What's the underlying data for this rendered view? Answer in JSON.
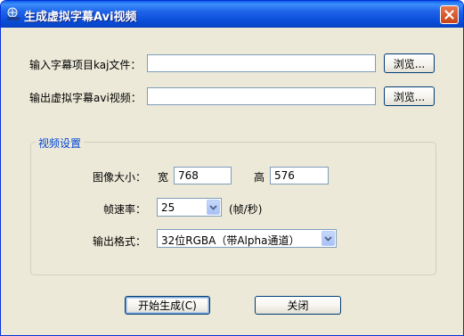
{
  "window": {
    "title": "生成虚拟字幕Avi视频",
    "app_icon": "avi-app-icon",
    "close_icon": "close-icon"
  },
  "input_project": {
    "label": "输入字幕项目kaj文件：",
    "value": "",
    "browse_label": "浏览..."
  },
  "output_video": {
    "label": "输出虚拟字幕avi视频：",
    "value": "",
    "browse_label": "浏览..."
  },
  "video_settings": {
    "group_title": "视频设置",
    "image_size_label": "图像大小：",
    "width_label": "宽",
    "width_value": "768",
    "height_label": "高",
    "height_value": "576",
    "frame_rate_label": "帧速率：",
    "frame_rate_value": "25",
    "frame_rate_unit": "(帧/秒)",
    "output_format_label": "输出格式：",
    "output_format_value": "32位RGBA（带Alpha通道）"
  },
  "buttons": {
    "start_label": "开始生成(C)",
    "close_label": "关闭"
  },
  "colors": {
    "title_bar": "#0A4ED9",
    "dialog_bg": "#ECE9D8",
    "group_title": "#0046D5",
    "close_button": "#D6532A"
  }
}
